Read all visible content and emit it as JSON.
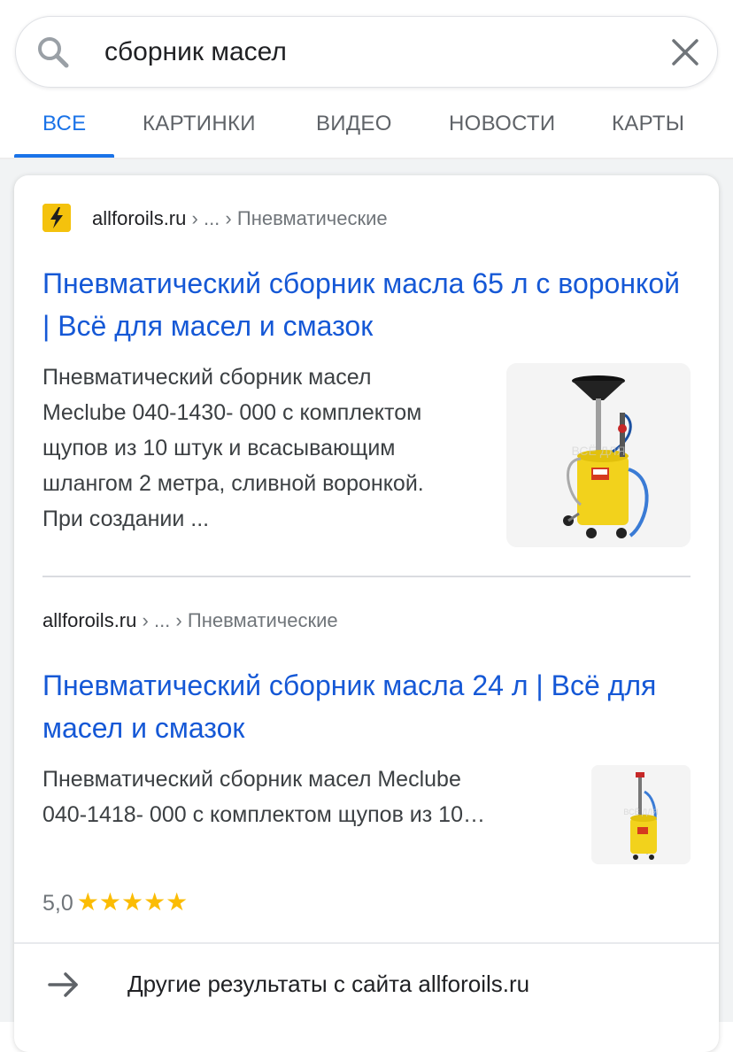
{
  "search": {
    "query": "сборник масел"
  },
  "tabs": [
    {
      "label": "ВСЕ"
    },
    {
      "label": "КАРТИНКИ"
    },
    {
      "label": "ВИДЕО"
    },
    {
      "label": "НОВОСТИ"
    },
    {
      "label": "КАРТЫ"
    }
  ],
  "active_tab": "ВСЕ",
  "icons": {
    "search": "search-icon",
    "clear": "close-icon",
    "favicon": "lightning-favicon",
    "more": "arrow-right-icon"
  },
  "colors": {
    "accent": "#1a73e8",
    "link": "#1558d6",
    "star": "#fbbc04",
    "favicon_bg": "#f4c20d"
  },
  "results": [
    {
      "site": "allforoils.ru",
      "sep1": "›",
      "ellipsis": "...",
      "sep2": "›",
      "crumb": "Пневматические",
      "title": "Пневматический сборник масла 65 л с воронкой | Всё для масел и смазок",
      "snippet": [
        "Пневматический сборник масел",
        "Meclube 040-1430- 000 с комплектом",
        "щупов из 10 штук и всасывающим",
        "шлангом 2 метра, сливной воронкой.",
        "При создании  ..."
      ],
      "image": "yellow pneumatic oil collector with funnel"
    },
    {
      "site": "allforoils.ru",
      "sep1": "›",
      "ellipsis": "...",
      "sep2": "›",
      "crumb": "Пневматические",
      "title": "Пневматический сборник масла 24 л | Всё для масел и смазок",
      "snippet": [
        "Пневматический сборник масел Meclube",
        "040-1418- 000 с комплектом щупов из 10…"
      ],
      "rating": "5,0",
      "stars": "★★★★★",
      "image": "small yellow pneumatic oil collector"
    }
  ],
  "more_results": "Другие результаты с сайта allforoils.ru"
}
